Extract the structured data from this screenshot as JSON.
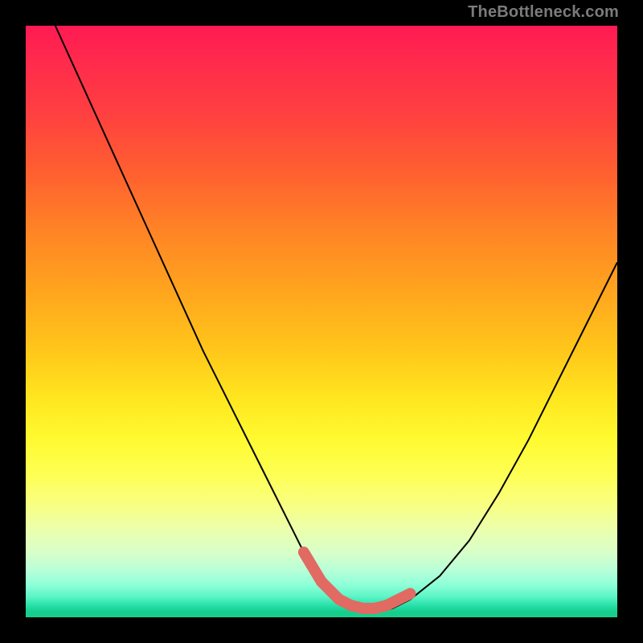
{
  "watermark": "TheBottleneck.com",
  "chart_data": {
    "type": "line",
    "title": "",
    "xlabel": "",
    "ylabel": "",
    "xlim": [
      0,
      100
    ],
    "ylim": [
      0,
      100
    ],
    "background_gradient_stops": [
      {
        "pos": 0.0,
        "color": "#ff1a53"
      },
      {
        "pos": 0.06,
        "color": "#ff2a4c"
      },
      {
        "pos": 0.15,
        "color": "#ff4040"
      },
      {
        "pos": 0.25,
        "color": "#ff6030"
      },
      {
        "pos": 0.35,
        "color": "#ff8525"
      },
      {
        "pos": 0.45,
        "color": "#ffa51e"
      },
      {
        "pos": 0.55,
        "color": "#ffc71a"
      },
      {
        "pos": 0.63,
        "color": "#ffe61f"
      },
      {
        "pos": 0.7,
        "color": "#fffa30"
      },
      {
        "pos": 0.76,
        "color": "#feff55"
      },
      {
        "pos": 0.81,
        "color": "#f8ff82"
      },
      {
        "pos": 0.85,
        "color": "#ecffab"
      },
      {
        "pos": 0.89,
        "color": "#d8ffc8"
      },
      {
        "pos": 0.92,
        "color": "#b8ffd8"
      },
      {
        "pos": 0.945,
        "color": "#8effd8"
      },
      {
        "pos": 0.965,
        "color": "#5cf5c6"
      },
      {
        "pos": 0.98,
        "color": "#28e0a8"
      },
      {
        "pos": 0.99,
        "color": "#17cf8d"
      },
      {
        "pos": 1.0,
        "color": "#17cf8d"
      }
    ],
    "series": [
      {
        "name": "bottleneck-curve",
        "color": "#000000",
        "x": [
          5,
          10,
          15,
          20,
          25,
          30,
          35,
          40,
          45,
          47,
          50,
          53,
          56,
          58,
          60,
          62,
          65,
          70,
          75,
          80,
          85,
          90,
          95,
          100
        ],
        "y": [
          100,
          89,
          78,
          67,
          56,
          45,
          35,
          25,
          15,
          11,
          6,
          3,
          1.5,
          1,
          1,
          1.5,
          3,
          7,
          13,
          21,
          30,
          40,
          50,
          60
        ]
      }
    ],
    "highlight_band": {
      "name": "optimal-range",
      "color": "#e16a63",
      "x": [
        47,
        50,
        53,
        55,
        57,
        59,
        61,
        63,
        65
      ],
      "y": [
        11,
        6,
        3,
        2,
        1.5,
        1.5,
        2,
        3,
        4
      ]
    }
  }
}
